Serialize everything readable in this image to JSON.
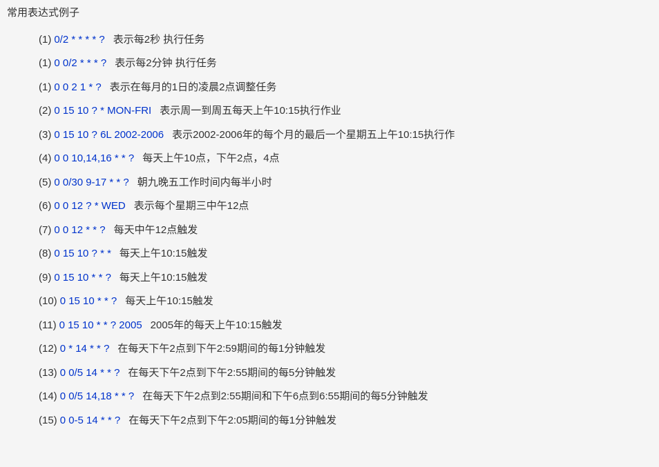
{
  "title": "常用表达式例子",
  "rows": [
    {
      "num": "(1)",
      "expr": "0/2 * * * * ?",
      "desc": "表示每2秒 执行任务"
    },
    {
      "num": "(1)",
      "expr": "0 0/2 * * * ?",
      "desc": "表示每2分钟 执行任务"
    },
    {
      "num": "(1)",
      "expr": "0 0 2 1 * ?",
      "desc": "表示在每月的1日的凌晨2点调整任务"
    },
    {
      "num": "(2)",
      "expr": "0 15 10 ? * MON-FRI",
      "desc": "表示周一到周五每天上午10:15执行作业"
    },
    {
      "num": "(3)",
      "expr": "0 15 10 ? 6L 2002-2006",
      "desc": "表示2002-2006年的每个月的最后一个星期五上午10:15执行作"
    },
    {
      "num": "(4)",
      "expr": "0 0 10,14,16 * * ?",
      "desc": "每天上午10点，下午2点，4点"
    },
    {
      "num": "(5)",
      "expr": "0 0/30 9-17 * * ?",
      "desc": "朝九晚五工作时间内每半小时"
    },
    {
      "num": "(6)",
      "expr": "0 0 12 ? * WED",
      "desc": "表示每个星期三中午12点"
    },
    {
      "num": "(7)",
      "expr": "0 0 12 * * ?",
      "desc": "每天中午12点触发"
    },
    {
      "num": "(8)",
      "expr": "0 15 10 ? * *",
      "desc": "每天上午10:15触发"
    },
    {
      "num": "(9)",
      "expr": "0 15 10 * * ?",
      "desc": "每天上午10:15触发"
    },
    {
      "num": "(10)",
      "expr": "0 15 10 * * ?",
      "desc": "每天上午10:15触发"
    },
    {
      "num": "(11)",
      "expr": "0 15 10 * * ? 2005",
      "desc": "2005年的每天上午10:15触发"
    },
    {
      "num": "(12)",
      "expr": "0 * 14 * * ?",
      "desc": "在每天下午2点到下午2:59期间的每1分钟触发"
    },
    {
      "num": "(13)",
      "expr": "0 0/5 14 * * ?",
      "desc": "在每天下午2点到下午2:55期间的每5分钟触发"
    },
    {
      "num": "(14)",
      "expr": "0 0/5 14,18 * * ?",
      "desc": "在每天下午2点到2:55期间和下午6点到6:55期间的每5分钟触发"
    },
    {
      "num": "(15)",
      "expr": "0 0-5 14 * * ?",
      "desc": "在每天下午2点到下午2:05期间的每1分钟触发"
    }
  ]
}
